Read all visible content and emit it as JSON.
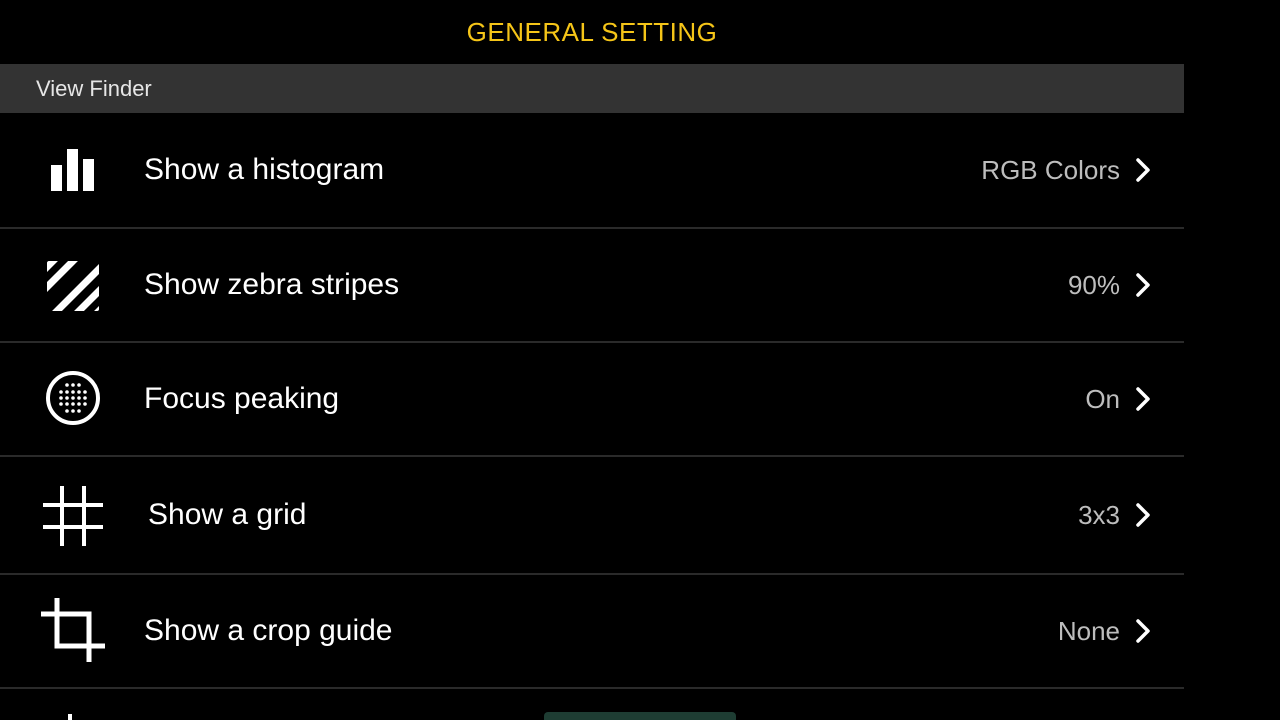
{
  "header": {
    "title": "GENERAL SETTING"
  },
  "section": {
    "label": "View Finder"
  },
  "rows": [
    {
      "label": "Show a histogram",
      "value": "RGB Colors",
      "icon": "histogram-icon"
    },
    {
      "label": "Show zebra stripes",
      "value": "90%",
      "icon": "zebra-stripes-icon"
    },
    {
      "label": "Focus peaking",
      "value": "On",
      "icon": "focus-peaking-icon"
    },
    {
      "label": "Show a grid",
      "value": "3x3",
      "icon": "grid-icon"
    },
    {
      "label": "Show a crop guide",
      "value": "None",
      "icon": "crop-icon"
    }
  ],
  "colors": {
    "title": "#F5C518",
    "section_bar": "#333333",
    "background": "#000000",
    "label": "#FFFFFF",
    "value": "#BDBDBD",
    "bottom_tab": "#1e3d33"
  }
}
